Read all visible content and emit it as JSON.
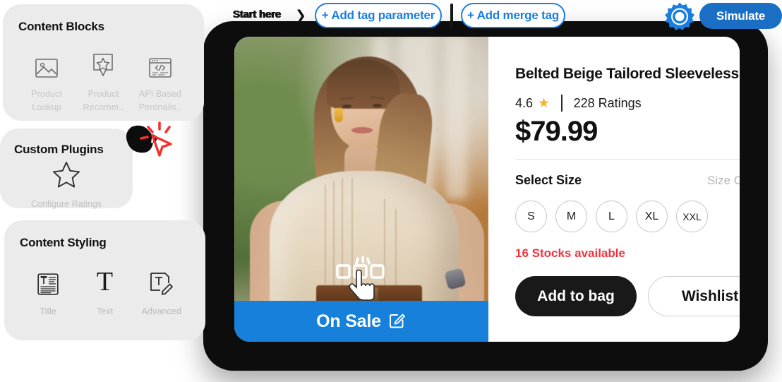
{
  "toolbar": {
    "start_here_label": "Start here",
    "chevron_icon": "chevron-right-icon",
    "add_tag_parameter_label": "+ Add tag parameter",
    "add_merge_tag_label": "+ Add merge tag",
    "gear_icon": "gear-icon",
    "simulate_label": "Simulate",
    "accent_blue": "#1a7ee0",
    "simulate_bg": "#1a6fc4"
  },
  "panels": [
    {
      "id": "content-blocks",
      "title": "Content Blocks",
      "tiles": [
        {
          "icon": "image-icon",
          "label": "Product\nLookup",
          "line1": "Product",
          "line2": "Lookup"
        },
        {
          "icon": "star-bubble-icon",
          "label": "Product\nRecomm..",
          "line1": "Product",
          "line2": "Recomm.."
        },
        {
          "icon": "code-window-icon",
          "label": "API Based\nPeronalis..",
          "line1": "API Based",
          "line2": "Peronalis.."
        }
      ]
    },
    {
      "id": "custom-plugins",
      "title": "Custom Plugins",
      "tiles": [
        {
          "icon": "star-outline-icon",
          "label": "Configure Ratings"
        }
      ]
    },
    {
      "id": "content-styling",
      "title": "Content Styling",
      "tiles": [
        {
          "icon": "title-block-icon",
          "label": "Title"
        },
        {
          "icon": "text-t-icon",
          "label": "Text"
        },
        {
          "icon": "text-edit-icon",
          "label": "Advanced"
        }
      ]
    }
  ],
  "cursor": {
    "red_cursor_icon": "cursor-click-icon",
    "red": "#f2322f"
  },
  "product": {
    "title": "Belted Beige Tailored Sleeveless",
    "rating_score": "4.6",
    "star_icon": "star-filled-icon",
    "ratings_count": "228 Ratings",
    "price": "$79.99",
    "select_size_label": "Select Size",
    "size_chart_label": "Size Chart",
    "size_chart_chevron": "chevron-right-icon",
    "sizes": [
      "S",
      "M",
      "L",
      "XL",
      "XXL"
    ],
    "stock_text": "16 Stocks available",
    "stock_color": "#f5333f",
    "add_to_bag_label": "Add to bag",
    "wishlist_label": "Wishlist"
  },
  "preview": {
    "banner_text": "On Sale",
    "banner_edit_icon": "edit-pencil-icon",
    "banner_color": "#1680db",
    "overlay_icon": "hand-pointer-carousel-icon",
    "photo_alt": "fashion-model-photo"
  }
}
